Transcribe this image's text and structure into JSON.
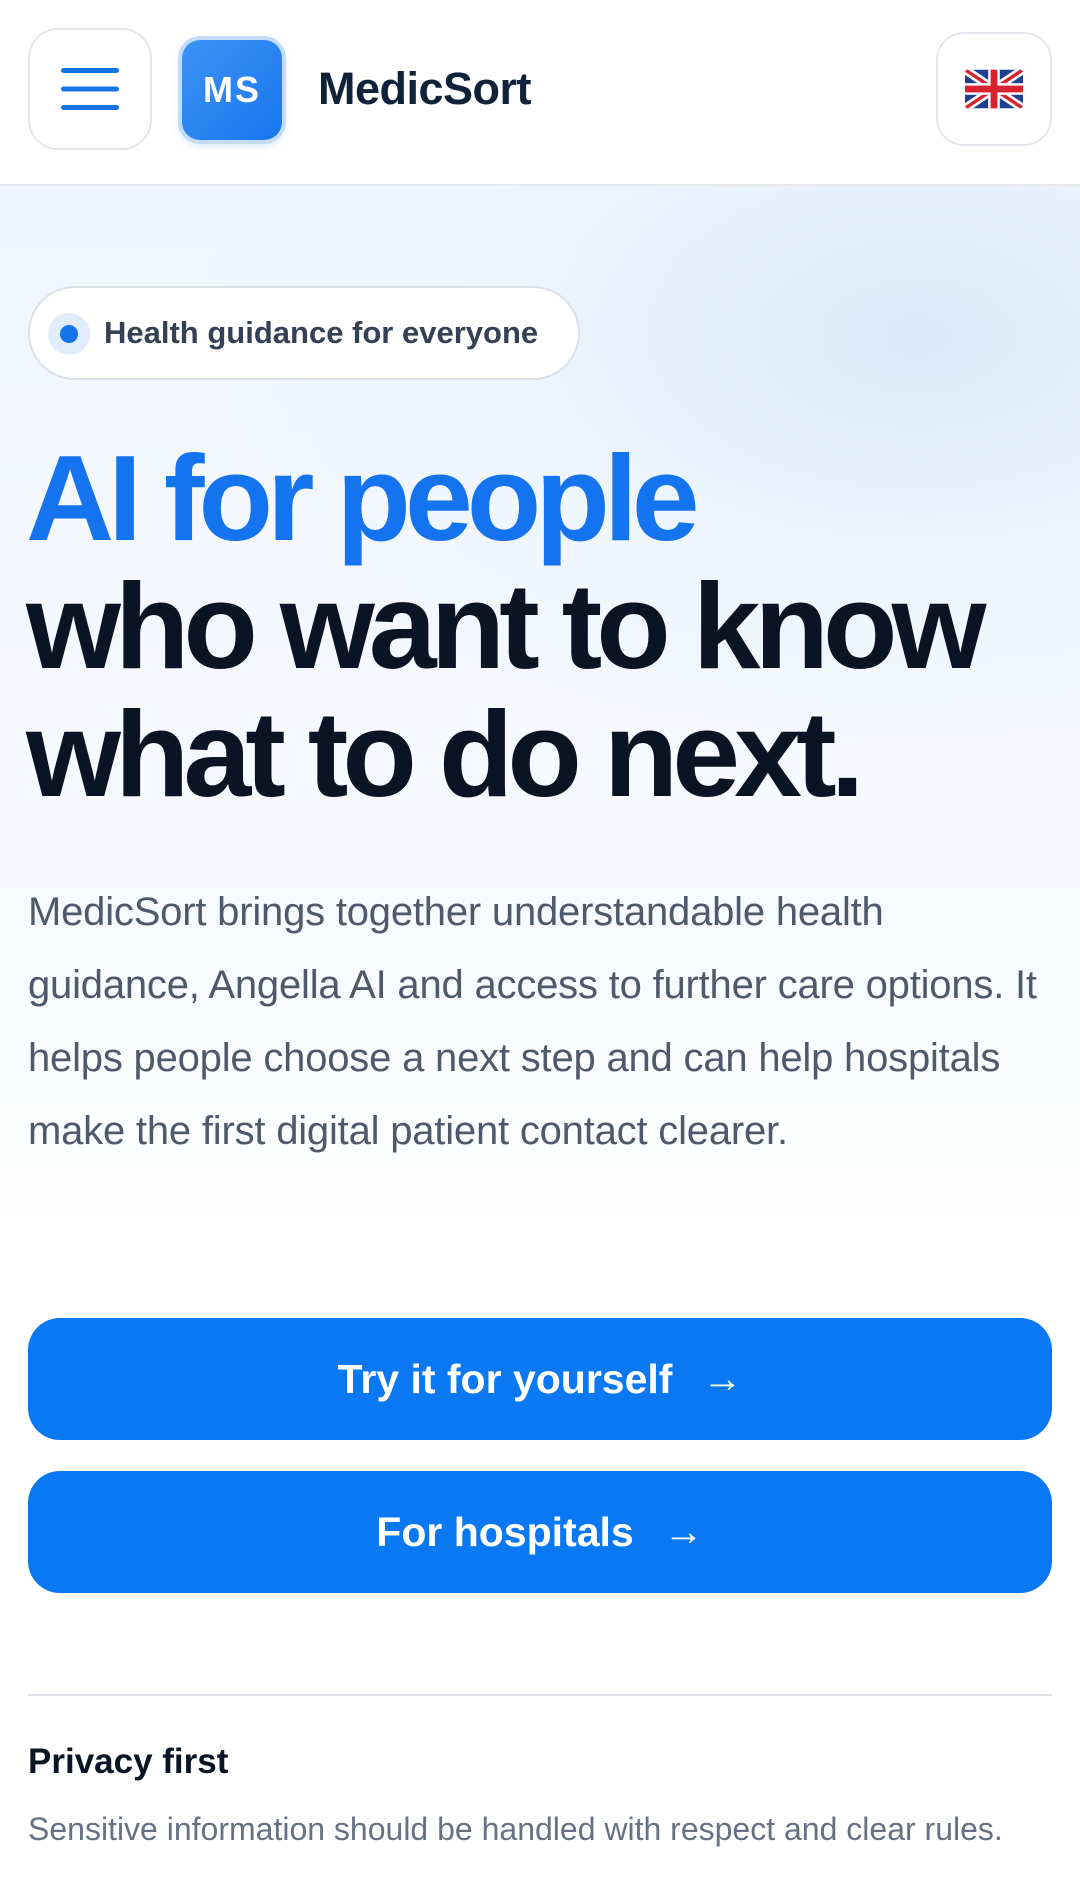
{
  "header": {
    "logo_text": "MS",
    "brand": "MedicSort",
    "language_flag": "uk-flag-icon"
  },
  "hero": {
    "badge": "Health guidance for everyone",
    "headline": {
      "line1": "AI for people",
      "line2": "who want to know",
      "line3": "what to do next."
    },
    "lead": "MedicSort brings together understandable health guidance, Angella AI and access to further care options. It helps people choose a next step and can help hospitals make the first digital patient contact clearer.",
    "cta_primary": "Try it for yourself",
    "cta_secondary": "For hospitals",
    "arrow": "→"
  },
  "features": [
    {
      "title": "Privacy first",
      "description": "Sensitive information should be handled with respect and clear rules."
    }
  ],
  "colors": {
    "accent": "#1473ee",
    "button": "#0a78f2",
    "heading": "#0b1424",
    "body_text": "#4e5a6b"
  }
}
